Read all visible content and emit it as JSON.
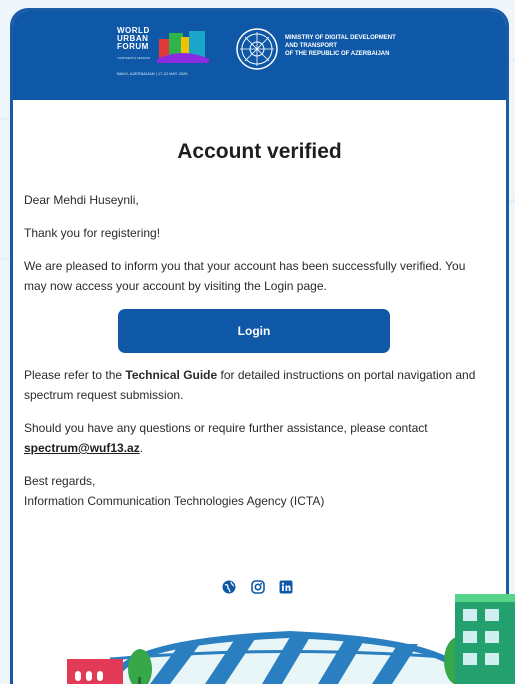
{
  "header": {
    "wuf_logo_lines": [
      "WORLD",
      "URBAN",
      "FORUM"
    ],
    "wuf_session": "THIRTEENTH SESSION",
    "wuf_dates": "BAKU, AZERBAIJAN | 17-22 MAY 2026",
    "ministry_lines": [
      "MINISTRY OF DIGITAL DEVELOPMENT",
      "AND TRANSPORT",
      "OF THE REPUBLIC OF AZERBAIJAN"
    ]
  },
  "email": {
    "title": "Account verified",
    "greeting": "Dear Mehdi Huseynli,",
    "thanks": "Thank you for registering!",
    "verified_text": "We are pleased to inform you that your account has been successfully verified. You may now access your account by visiting the Login page.",
    "login_button": "Login",
    "guide_prefix": "Please refer to the ",
    "guide_link": "Technical Guide",
    "guide_suffix": " for detailed instructions on portal navigation and spectrum request submission.",
    "contact_text": "Should you have any questions or require further assistance, please contact",
    "contact_email": "spectrum@wuf13.az",
    "contact_period": ".",
    "closing": "Best regards,",
    "signature": "Information Communication Technologies Agency (ICTA)"
  },
  "socials": [
    "globe-icon",
    "instagram-icon",
    "linkedin-icon"
  ],
  "colors": {
    "brand_blue": "#0f58a8",
    "background": "#eef6fb",
    "text": "#2b2b2b"
  }
}
